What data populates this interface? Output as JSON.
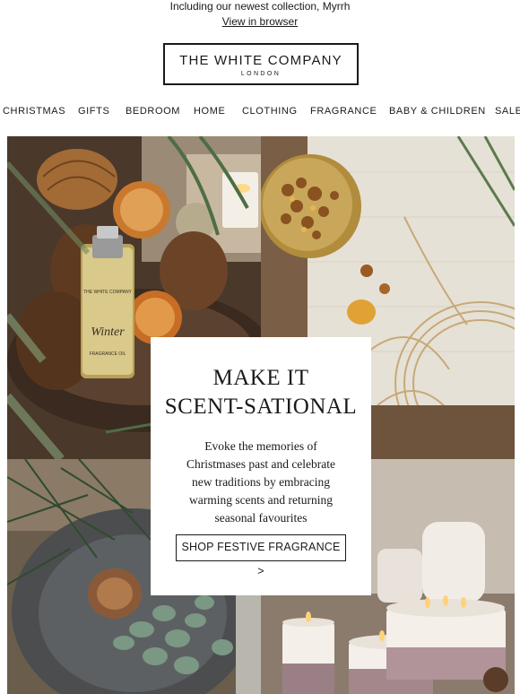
{
  "preheader": {
    "tagline": "Including our newest collection, Myrrh",
    "view_in_browser": "View in browser"
  },
  "logo": {
    "title": "THE WHITE COMPANY",
    "subtitle": "LONDON"
  },
  "nav": {
    "items": [
      "CHRISTMAS",
      "GIFTS",
      "BEDROOM",
      "HOME",
      "CLOTHING",
      "FRAGRANCE",
      "BABY & CHILDREN",
      "SALE"
    ]
  },
  "hero": {
    "title_line1": "MAKE IT",
    "title_line2": "SCENT-SATIONAL",
    "body_lines": [
      "Evoke the memories of",
      "Christmases past and celebrate",
      "new traditions by embracing",
      "warming scents and returning",
      "seasonal favourites"
    ],
    "cta": "SHOP FESTIVE FRAGRANCE >",
    "bottle_label_brand": "THE WHITE COMPANY",
    "bottle_label_name": "Winter",
    "bottle_label_type": "FRAGRANCE OIL"
  },
  "colors": {
    "text": "#1a1a1a",
    "background": "#ffffff"
  }
}
